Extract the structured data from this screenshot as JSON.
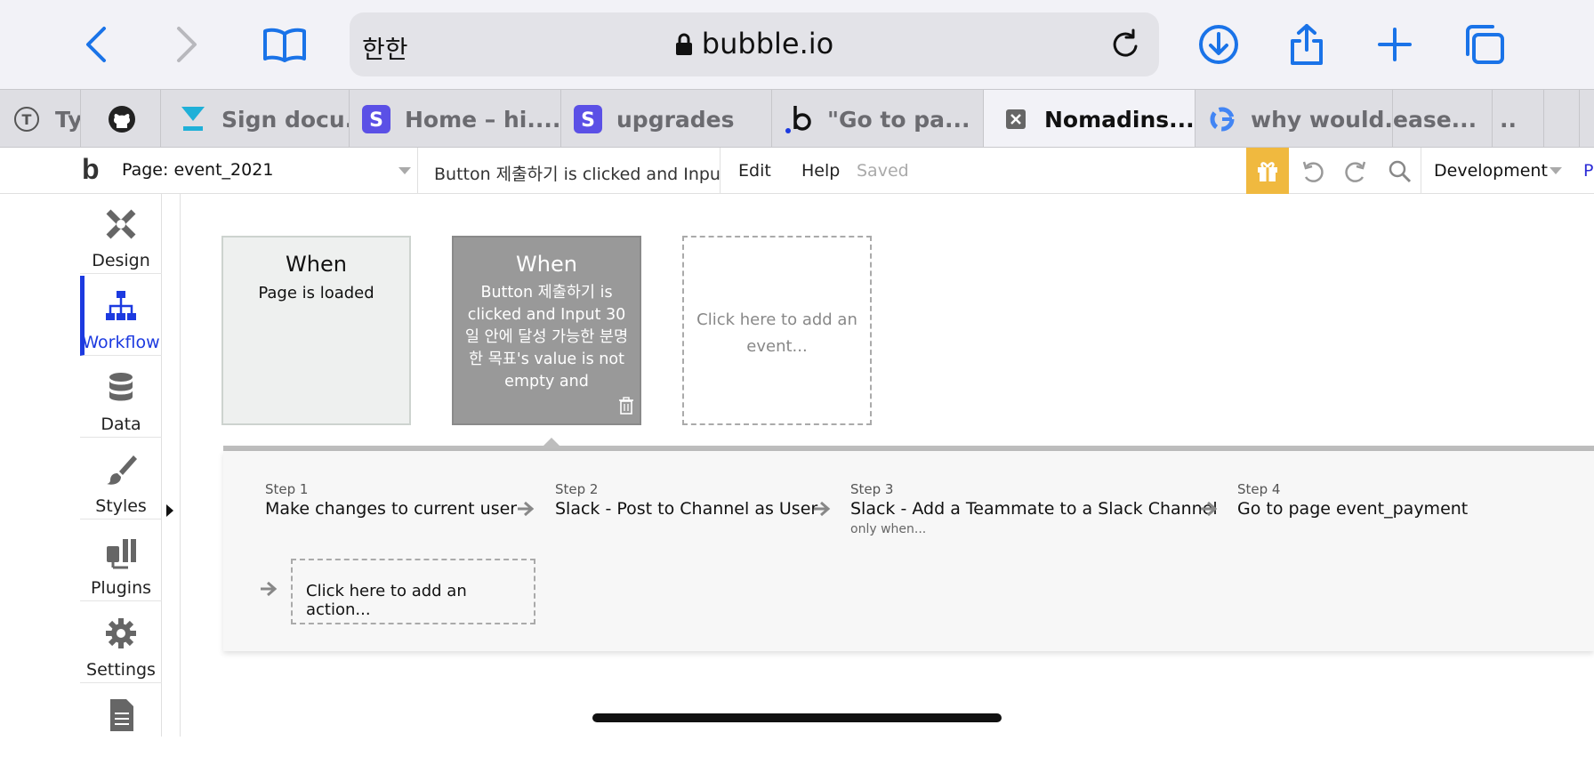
{
  "browser": {
    "aa_label": "한한",
    "url": "bubble.io",
    "tabs": [
      {
        "label": "Ty",
        "icon": "t-circle-icon",
        "active": false
      },
      {
        "label": "",
        "icon": "github-icon",
        "active": false
      },
      {
        "label": "Sign docu...",
        "icon": "docusign-icon",
        "active": false
      },
      {
        "label": "Home – hi....",
        "icon": "s-app-icon",
        "active": false
      },
      {
        "label": "upgrades",
        "icon": "s-app-icon",
        "active": false
      },
      {
        "label": "\"Go to pa...",
        "icon": "bubble-icon",
        "active": false
      },
      {
        "label": "Nomadins...",
        "icon": "close-icon",
        "active": true
      },
      {
        "label": "why would...",
        "icon": "google-icon",
        "active": false
      },
      {
        "label": "ease...",
        "icon": "",
        "active": false
      },
      {
        "label": "..",
        "icon": "",
        "active": false
      }
    ]
  },
  "toolbar": {
    "logo": "b",
    "page_label": "Page: event_2021",
    "event_label": "Button 제출하기 is clicked and Input...",
    "edit": "Edit",
    "help": "Help",
    "saved": "Saved",
    "environment": "Development",
    "partial": "P"
  },
  "sidebar": {
    "items": [
      {
        "label": "Design",
        "icon": "design-icon"
      },
      {
        "label": "Workflow",
        "icon": "workflow-icon",
        "active": true
      },
      {
        "label": "Data",
        "icon": "database-icon"
      },
      {
        "label": "Styles",
        "icon": "brush-icon"
      },
      {
        "label": "Plugins",
        "icon": "plugins-icon"
      },
      {
        "label": "Settings",
        "icon": "gear-icon"
      }
    ]
  },
  "events": [
    {
      "title": "When",
      "body": "Page is loaded"
    },
    {
      "title": "When",
      "body": "Button 제출하기 is clicked and Input 30일 안에 달성 가능한 분명한 목표's value is not empty and PictureUploader 지가 느끼기 에 모르고"
    },
    {
      "title": "",
      "body": "Click here to add an event..."
    }
  ],
  "steps": [
    {
      "num": "Step 1",
      "name": "Make changes to current user",
      "cond": ""
    },
    {
      "num": "Step 2",
      "name": "Slack - Post to Channel as User",
      "cond": ""
    },
    {
      "num": "Step 3",
      "name": "Slack - Add a Teammate to a Slack Channel",
      "cond": "only when..."
    },
    {
      "num": "Step 4",
      "name": "Go to page event_payment",
      "cond": ""
    }
  ],
  "add_action": "Click here to add an action...",
  "colors": {
    "accent": "#1a73e8",
    "workflow_active": "#1c3ae0",
    "gift": "#f0b93f",
    "selected_event": "#999999"
  }
}
